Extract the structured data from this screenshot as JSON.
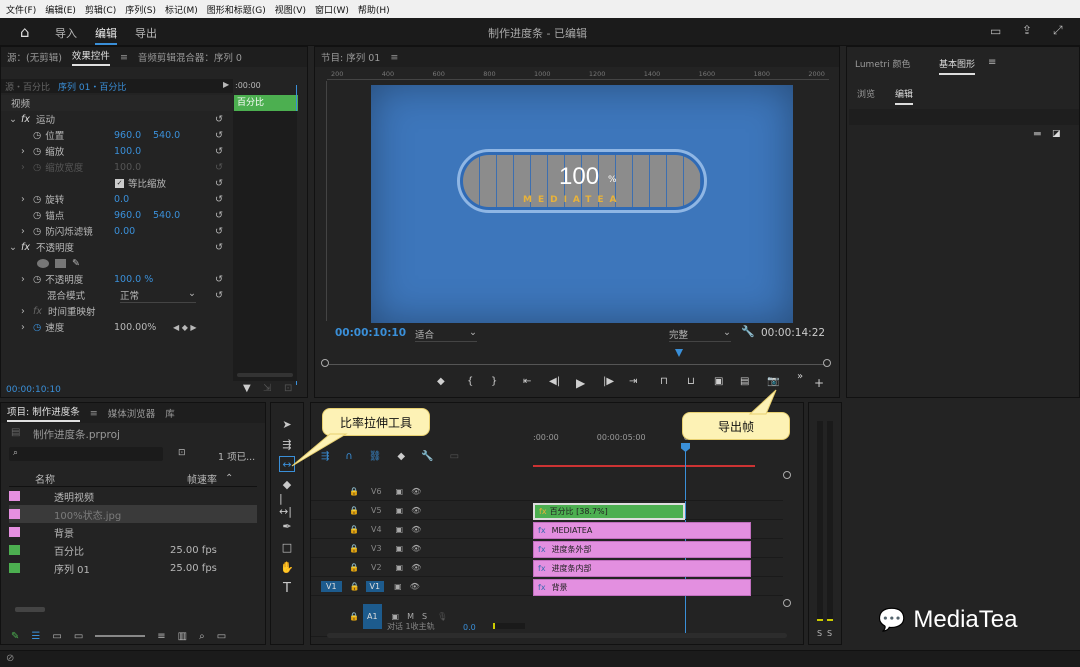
{
  "menu": [
    "文件(F)",
    "编辑(E)",
    "剪辑(C)",
    "序列(S)",
    "标记(M)",
    "图形和标题(G)",
    "视图(V)",
    "窗口(W)",
    "帮助(H)"
  ],
  "workspace": {
    "import": "导入",
    "edit": "编辑",
    "export": "导出",
    "title": "制作进度条 - 已编辑"
  },
  "source_panel": {
    "tab_source": "源：(无剪辑)",
    "tab_effects": "效果控件",
    "tab_audio": "音频剪辑混合器：序列 0",
    "clip_path": "源・百分比",
    "seq_path": "序列 01・百分比",
    "time_start": ":00:00",
    "clip_label": "百分比",
    "timecode": "00:00:10:10"
  },
  "effects": {
    "video": "视频",
    "motion": "运动",
    "position": "位置",
    "pos_x": "960.0",
    "pos_y": "540.0",
    "scale": "缩放",
    "scale_v": "100.0",
    "scale_w": "缩放宽度",
    "scale_w_v": "100.0",
    "uniform": "等比缩放",
    "rotation": "旋转",
    "rotation_v": "0.0",
    "anchor": "锚点",
    "anchor_x": "960.0",
    "anchor_y": "540.0",
    "flicker": "防闪烁滤镜",
    "flicker_v": "0.00",
    "opacity_group": "不透明度",
    "opacity": "不透明度",
    "opacity_v": "100.0 %",
    "blend": "混合模式",
    "blend_v": "正常",
    "remap": "时间重映射",
    "speed": "速度",
    "speed_v": "100.00%"
  },
  "program": {
    "title": "节目: 序列 01",
    "ruler": [
      "200",
      "400",
      "600",
      "800",
      "1000",
      "1200",
      "1400",
      "1600",
      "1800",
      "2000"
    ],
    "timecode": "00:00:10:10",
    "fit": "适合",
    "quality": "完整",
    "duration": "00:00:14:22",
    "percent": "100",
    "percent_sign": "%",
    "brand": "MEDIATEA"
  },
  "lumetri": {
    "tab1": "Lumetri 颜色",
    "tab2": "基本图形",
    "browse": "浏览",
    "edit": "编辑"
  },
  "project": {
    "tab": "项目: 制作进度条",
    "media": "媒体浏览器",
    "lib": "库",
    "file": "制作进度条.prproj",
    "count": "1 项已...",
    "col_name": "名称",
    "col_rate": "帧速率",
    "items": [
      {
        "name": "透明视频",
        "rate": "",
        "color": "#e58fe0"
      },
      {
        "name": "100%状态.jpg",
        "rate": "",
        "color": "#e58fe0"
      },
      {
        "name": "背景",
        "rate": "",
        "color": "#e58fe0"
      },
      {
        "name": "百分比",
        "rate": "25.00 fps",
        "color": "#4caf50"
      },
      {
        "name": "序列 01",
        "rate": "25.00 fps",
        "color": "#4caf50"
      }
    ]
  },
  "timeline": {
    "ruler": [
      ":00:00",
      "00:00:05:00",
      "00:00"
    ],
    "tracks": [
      "V6",
      "V5",
      "V4",
      "V3",
      "V2",
      "V1"
    ],
    "audio": "A1",
    "audio_label": "对话 1收主轨",
    "audio_val": "0.0",
    "clips": [
      {
        "label": "百分比 [38.7%]",
        "color": "#4caf50"
      },
      {
        "label": "MEDIATEA",
        "color": "#e38fe0"
      },
      {
        "label": "进度条外部",
        "color": "#e38fe0"
      },
      {
        "label": "进度条内部",
        "color": "#e38fe0"
      },
      {
        "label": "背景",
        "color": "#e38fe0"
      }
    ]
  },
  "callouts": {
    "stretch": "比率拉伸工具",
    "export_frame": "导出帧"
  },
  "watermark": "MediaTea",
  "meter": {
    "s1": "S",
    "s2": "S"
  }
}
